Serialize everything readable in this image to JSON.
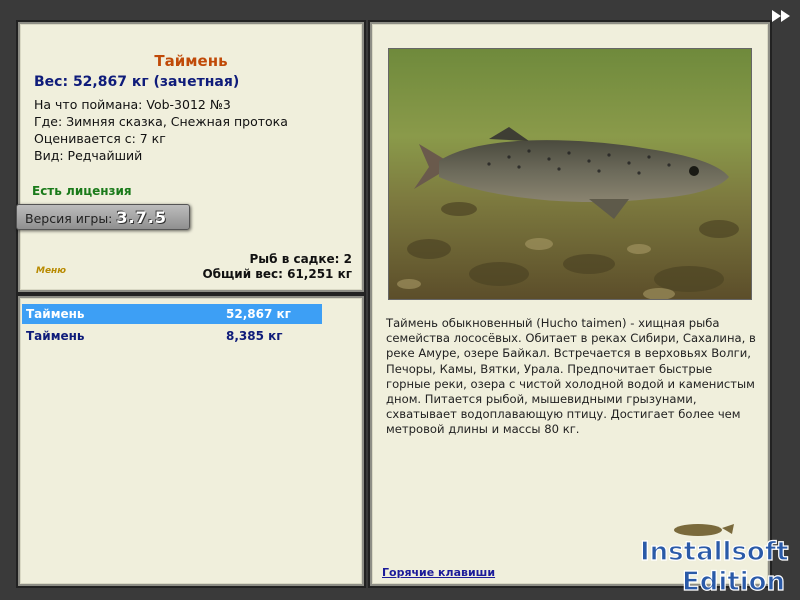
{
  "fish_info": {
    "title": "Таймень",
    "weight": "Вес: 52,867 кг (зачетная)",
    "bait": "На что поймана: Vob-3012 №3",
    "location": "Где: Зимняя сказка, Снежная протока",
    "valued_from": "Оценивается с: 7 кг",
    "rarity": "Вид: Редчайший",
    "license": "Есть лицензия",
    "version_label": "Версия игры:",
    "version_number": "3.7.5",
    "fish_in_net": "Рыб в садке: 2",
    "total_weight": "Общий вес: 61,251 кг",
    "menu_label": "Меню"
  },
  "catch_list": [
    {
      "name": "Таймень",
      "weight": "52,867 кг",
      "selected": true
    },
    {
      "name": "Таймень",
      "weight": "8,385 кг",
      "selected": false
    }
  ],
  "description": {
    "text": "Таймень обыкновенный (Hucho taimen) - хищная рыба семейства лососёвых. Обитает в реках Сибири, Сахалина, в реке Амуре, озере Байкал. Встречается в верховьях Волги, Печоры, Камы, Вятки, Урала. Предпочитает быстрые горные реки, озера с чистой холодной водой и каменистым дном. Питается рыбой, мышевидными грызунами, схватывает водоплавающую птицу. Достигает более чем метровой длины и массы 80 кг.",
    "hotkeys_link": "Горячие клавиши"
  },
  "watermark": {
    "line1": "Installsoft",
    "line2": "Edition"
  },
  "icons": {
    "fast_forward": "fast-forward-icon",
    "photo": "fish-photo"
  },
  "colors": {
    "title": "#c04a08",
    "weight": "#0f1c7a",
    "license": "#1a7a1a",
    "selected_row": "#3d9ff5",
    "panel_bg": "#f0efdc"
  }
}
